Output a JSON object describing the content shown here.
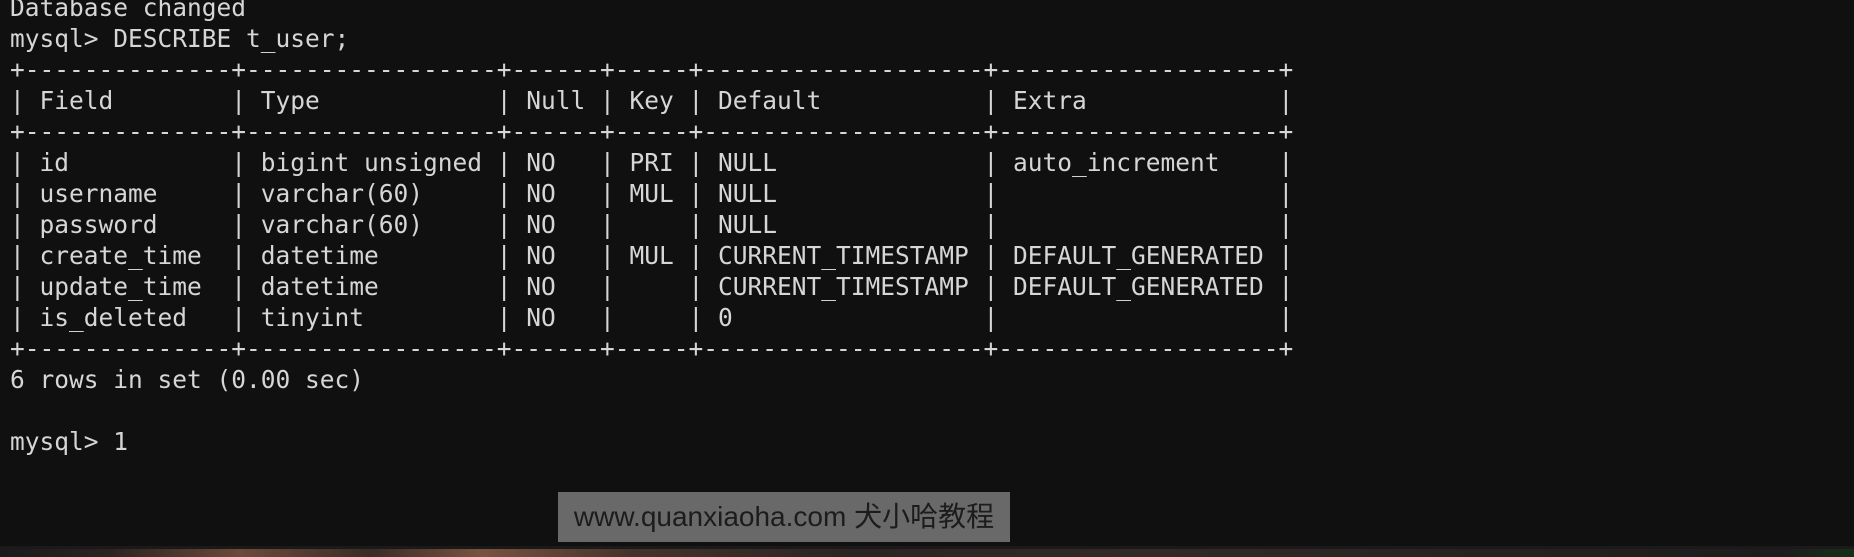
{
  "terminal": {
    "prompt": "mysql> ",
    "status_line_top": "Database changed",
    "command": "DESCRIBE t_user;",
    "result_footer": "6 rows in set (0.00 sec)",
    "final_prompt_line": "mysql> 1",
    "background_color": "#101010",
    "foreground_color": "#d6d6d6"
  },
  "table": {
    "rule_top": "+--------------+-----------------+------+-----+-------------------+-------------------+",
    "rule_header": "+--------------+-----------------+------+-----+-------------------+-------------------+",
    "rule_bottom": "+--------------+-----------------+------+-----+-------------------+-------------------+",
    "columns": [
      "Field",
      "Type",
      "Null",
      "Key",
      "Default",
      "Extra"
    ],
    "header_line": "| Field        | Type            | Null | Key | Default           | Extra             |",
    "rows": [
      {
        "line": "| id           | bigint unsigned | NO   | PRI | NULL              | auto_increment    |",
        "Field": "id",
        "Type": "bigint unsigned",
        "Null": "NO",
        "Key": "PRI",
        "Default": "NULL",
        "Extra": "auto_increment"
      },
      {
        "line": "| username     | varchar(60)     | NO   | MUL | NULL              |                   |",
        "Field": "username",
        "Type": "varchar(60)",
        "Null": "NO",
        "Key": "MUL",
        "Default": "NULL",
        "Extra": ""
      },
      {
        "line": "| password     | varchar(60)     | NO   |     | NULL              |                   |",
        "Field": "password",
        "Type": "varchar(60)",
        "Null": "NO",
        "Key": "",
        "Default": "NULL",
        "Extra": ""
      },
      {
        "line": "| create_time  | datetime        | NO   | MUL | CURRENT_TIMESTAMP | DEFAULT_GENERATED |",
        "Field": "create_time",
        "Type": "datetime",
        "Null": "NO",
        "Key": "MUL",
        "Default": "CURRENT_TIMESTAMP",
        "Extra": "DEFAULT_GENERATED"
      },
      {
        "line": "| update_time  | datetime        | NO   |     | CURRENT_TIMESTAMP | DEFAULT_GENERATED |",
        "Field": "update_time",
        "Type": "datetime",
        "Null": "NO",
        "Key": "",
        "Default": "CURRENT_TIMESTAMP",
        "Extra": "DEFAULT_GENERATED"
      },
      {
        "line": "| is_deleted   | tinyint         | NO   |     | 0                 |                   |",
        "Field": "is_deleted",
        "Type": "tinyint",
        "Null": "NO",
        "Key": "",
        "Default": "0",
        "Extra": ""
      }
    ]
  },
  "command_line": {
    "full": "mysql> DESCRIBE t_user;"
  },
  "watermark": {
    "text": "www.quanxiaoha.com 犬小哈教程"
  }
}
